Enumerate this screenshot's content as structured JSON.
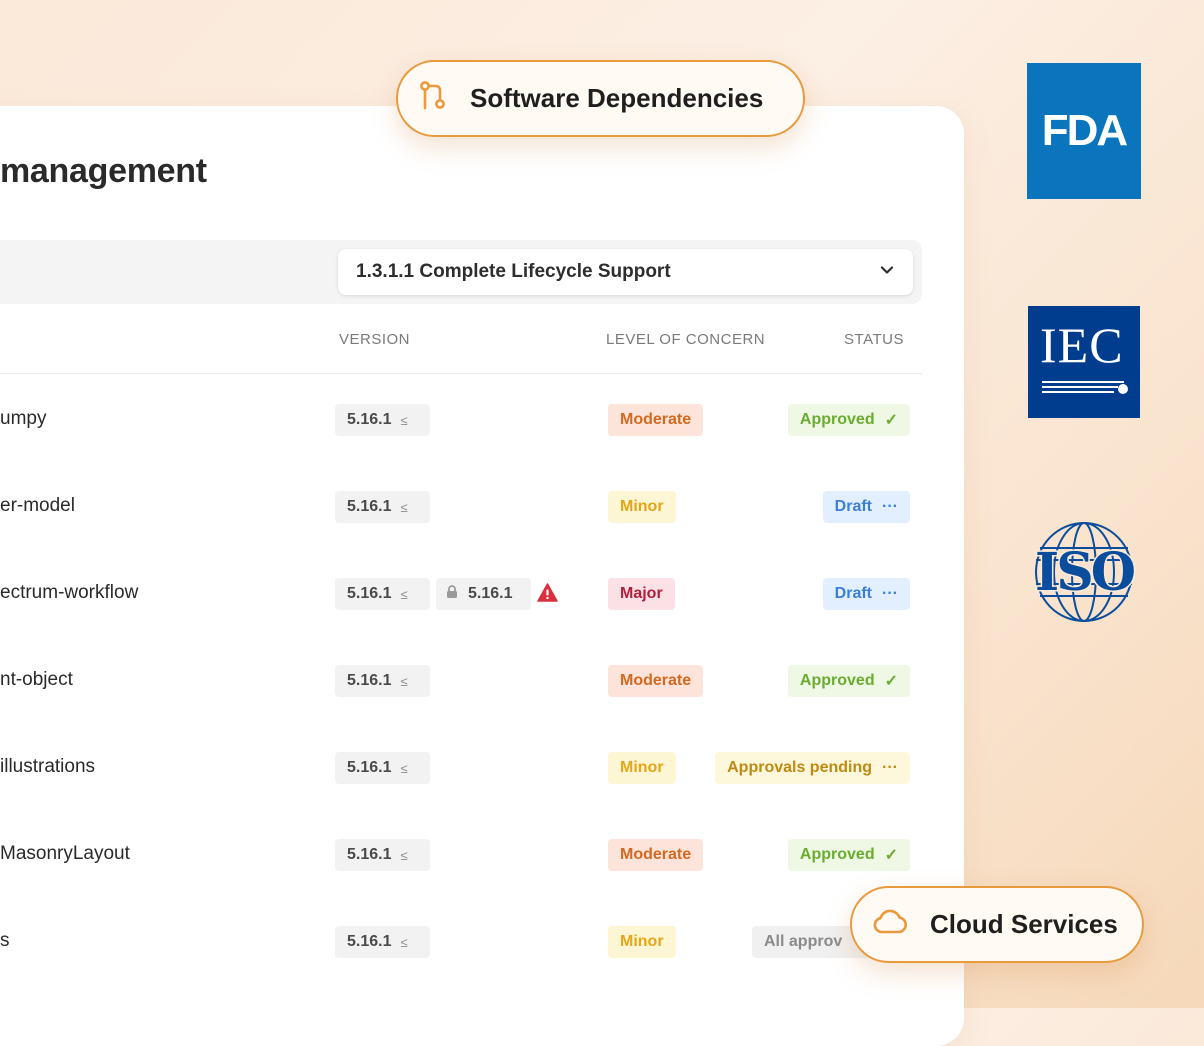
{
  "page": {
    "title": "management"
  },
  "filter": {
    "selected": "1.3.1.1 Complete Lifecycle Support"
  },
  "columns": {
    "version": "VERSION",
    "concern": "LEVEL OF CONCERN",
    "status": "STATUS"
  },
  "rows": [
    {
      "name": "umpy",
      "version": "5.16.1",
      "version_icon": "less-equal-icon",
      "concern": "Moderate",
      "status": "Approved",
      "status_icon": "check-icon"
    },
    {
      "name": "er-model",
      "version": "5.16.1",
      "version_icon": "less-equal-icon",
      "concern": "Minor",
      "status": "Draft",
      "status_icon": "ellipsis-icon"
    },
    {
      "name": "ectrum-workflow",
      "version": "5.16.1",
      "version_icon": "less-equal-icon",
      "locked_version": "5.16.1",
      "warning_icon": "warning-triangle-icon",
      "concern": "Major",
      "status": "Draft",
      "status_icon": "ellipsis-icon"
    },
    {
      "name": "nt-object",
      "version": "5.16.1",
      "version_icon": "less-equal-icon",
      "concern": "Moderate",
      "status": "Approved",
      "status_icon": "check-icon"
    },
    {
      "name": "illustrations",
      "version": "5.16.1",
      "version_icon": "less-equal-icon",
      "concern": "Minor",
      "status": "Approvals pending",
      "status_icon": "ellipsis-icon"
    },
    {
      "name": "MasonryLayout",
      "version": "5.16.1",
      "version_icon": "less-equal-icon",
      "concern": "Moderate",
      "status": "Approved",
      "status_icon": "check-icon"
    },
    {
      "name": "s",
      "version": "5.16.1",
      "version_icon": "less-equal-icon",
      "concern": "Minor",
      "status": "All approv"
    }
  ],
  "badges": {
    "dependencies": {
      "label": "Software Dependencies",
      "icon": "git-branch-icon"
    },
    "cloud": {
      "label": "Cloud Services",
      "icon": "cloud-icon"
    }
  },
  "logos": {
    "fda": {
      "text": "FDA",
      "color": "#0a74bd"
    },
    "iec": {
      "text": "IEC",
      "color": "#003d8f"
    },
    "iso": {
      "text": "ISO",
      "color": "#0a4d9c"
    }
  },
  "colors": {
    "accent": "#e89a3c",
    "moderate": "#d4691f",
    "minor": "#e6a515",
    "major": "#b0203d",
    "approved": "#6aac2f",
    "draft": "#3d7fd6",
    "pending": "#c08a12"
  }
}
